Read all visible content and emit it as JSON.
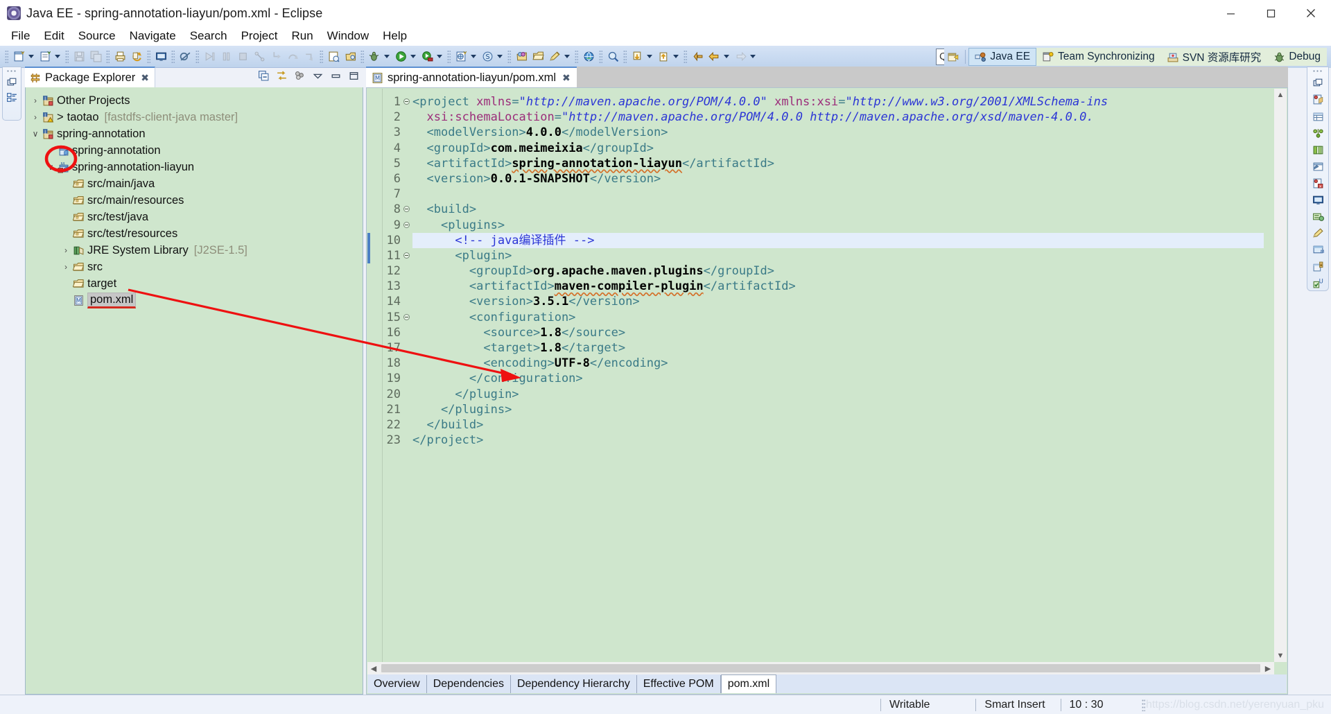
{
  "window": {
    "title": "Java EE - spring-annotation-liayun/pom.xml - Eclipse",
    "app_icon": "eclipse-icon",
    "controls": {
      "minimize": "minimize-icon",
      "maximize": "maximize-icon",
      "close": "close-icon"
    }
  },
  "menubar": {
    "items": [
      "File",
      "Edit",
      "Source",
      "Navigate",
      "Search",
      "Project",
      "Run",
      "Window",
      "Help"
    ]
  },
  "toolbar": {
    "groups": [
      {
        "buttons": [
          {
            "name": "new-wizard-icon",
            "arrow": true,
            "enabled": true
          },
          {
            "name": "new-java-file-icon",
            "arrow": true,
            "enabled": true
          }
        ]
      },
      {
        "buttons": [
          {
            "name": "save-icon",
            "arrow": false,
            "enabled": false
          },
          {
            "name": "save-all-icon",
            "arrow": false,
            "enabled": false
          }
        ]
      },
      {
        "buttons": [
          {
            "name": "print-icon",
            "arrow": false,
            "enabled": true
          },
          {
            "name": "refresh-icon",
            "arrow": false,
            "enabled": true
          }
        ]
      },
      {
        "buttons": [
          {
            "name": "open-console-icon",
            "arrow": false,
            "enabled": true
          }
        ]
      },
      {
        "buttons": [
          {
            "name": "toggle-breakpoint-icon",
            "arrow": false,
            "enabled": true
          }
        ]
      },
      {
        "buttons": [
          {
            "name": "resume-icon",
            "arrow": false,
            "enabled": false
          },
          {
            "name": "suspend-icon",
            "arrow": false,
            "enabled": false
          },
          {
            "name": "terminate-icon",
            "arrow": false,
            "enabled": false
          },
          {
            "name": "disconnect-icon",
            "arrow": false,
            "enabled": false
          },
          {
            "name": "step-into-icon",
            "arrow": false,
            "enabled": false
          },
          {
            "name": "step-over-icon",
            "arrow": false,
            "enabled": false
          },
          {
            "name": "step-return-icon",
            "arrow": false,
            "enabled": false
          }
        ]
      },
      {
        "buttons": [
          {
            "name": "open-type-icon",
            "arrow": false,
            "enabled": true
          },
          {
            "name": "open-task-icon",
            "arrow": false,
            "enabled": true
          }
        ]
      },
      {
        "buttons": [
          {
            "name": "debug-launch-icon",
            "arrow": true,
            "enabled": true
          },
          {
            "name": "run-launch-icon",
            "arrow": true,
            "enabled": true
          },
          {
            "name": "run-external-tools-icon",
            "arrow": true,
            "enabled": true
          }
        ]
      },
      {
        "buttons": [
          {
            "name": "new-server-icon",
            "arrow": true,
            "enabled": true
          },
          {
            "name": "new-ejb-project-icon",
            "arrow": true,
            "enabled": true
          }
        ]
      },
      {
        "buttons": [
          {
            "name": "open-web-browser-icon",
            "arrow": false,
            "enabled": true
          },
          {
            "name": "open-folder-icon",
            "arrow": false,
            "enabled": true
          },
          {
            "name": "edit-pencil-icon",
            "arrow": true,
            "enabled": true
          }
        ]
      },
      {
        "buttons": [
          {
            "name": "globe-icon",
            "arrow": false,
            "enabled": true
          }
        ]
      },
      {
        "buttons": [
          {
            "name": "search-icon",
            "arrow": false,
            "enabled": true
          }
        ]
      },
      {
        "buttons": [
          {
            "name": "commit-icon",
            "arrow": true,
            "enabled": true
          },
          {
            "name": "update-icon",
            "arrow": true,
            "enabled": true
          }
        ]
      },
      {
        "buttons": [
          {
            "name": "previous-annotation-icon",
            "arrow": false,
            "enabled": true
          },
          {
            "name": "back-navigation-icon",
            "arrow": true,
            "enabled": true
          },
          {
            "name": "forward-navigation-icon",
            "arrow": true,
            "enabled": false
          }
        ]
      }
    ]
  },
  "quick_access": {
    "label": "Quick Access",
    "placeholder": "Quick Access"
  },
  "perspectives": {
    "open_button": "open-perspective-icon",
    "items": [
      {
        "label": "Java EE",
        "icon": "java-ee-perspective-icon",
        "active": true
      },
      {
        "label": "Team Synchronizing",
        "icon": "team-sync-perspective-icon",
        "active": false
      },
      {
        "label": "SVN 资源库研究",
        "icon": "svn-repo-perspective-icon",
        "active": false
      },
      {
        "label": "Debug",
        "icon": "debug-perspective-icon",
        "active": false
      }
    ]
  },
  "left_stack": {
    "items": [
      {
        "name": "restore-view-icon"
      },
      {
        "name": "outline-view-icon"
      }
    ]
  },
  "package_explorer": {
    "tab_label": "Package Explorer",
    "tab_icon": "package-explorer-icon",
    "close_icon": "close-tab-icon",
    "tools": [
      {
        "name": "collapse-all-icon"
      },
      {
        "name": "link-with-editor-icon"
      },
      {
        "name": "view-menu-icon"
      },
      {
        "name": "minimize-view-icon"
      },
      {
        "name": "maximize-view-icon"
      }
    ],
    "tree": [
      {
        "indent": 0,
        "twisty": "collapsed",
        "icon": "java-project-closed-icon",
        "label": "Other Projects",
        "sub": "",
        "prefix": "",
        "selected": false
      },
      {
        "indent": 0,
        "twisty": "collapsed",
        "icon": "java-project-warn-icon",
        "label": "taotao",
        "sub": "[fastdfs-client-java master]",
        "prefix": ">",
        "selected": false
      },
      {
        "indent": 0,
        "twisty": "expanded",
        "icon": "maven-project-icon",
        "label": "spring-annotation",
        "sub": "",
        "prefix": "",
        "selected": false
      },
      {
        "indent": 1,
        "twisty": "collapsed",
        "icon": "maven-module-icon",
        "label": "spring-annotation",
        "sub": "",
        "prefix": "",
        "selected": false
      },
      {
        "indent": 1,
        "twisty": "expanded",
        "icon": "maven-module-error-icon",
        "label": "spring-annotation-liayun",
        "sub": "",
        "prefix": "",
        "selected": false,
        "circled": true
      },
      {
        "indent": 2,
        "twisty": "none",
        "icon": "source-folder-icon",
        "label": "src/main/java",
        "sub": "",
        "prefix": "",
        "selected": false
      },
      {
        "indent": 2,
        "twisty": "none",
        "icon": "source-folder-icon",
        "label": "src/main/resources",
        "sub": "",
        "prefix": "",
        "selected": false
      },
      {
        "indent": 2,
        "twisty": "none",
        "icon": "source-folder-icon",
        "label": "src/test/java",
        "sub": "",
        "prefix": "",
        "selected": false
      },
      {
        "indent": 2,
        "twisty": "none",
        "icon": "source-folder-icon",
        "label": "src/test/resources",
        "sub": "",
        "prefix": "",
        "selected": false
      },
      {
        "indent": 2,
        "twisty": "collapsed",
        "icon": "jre-library-icon",
        "label": "JRE System Library",
        "sub": "[J2SE-1.5]",
        "prefix": "",
        "selected": false
      },
      {
        "indent": 2,
        "twisty": "collapsed",
        "icon": "folder-icon",
        "label": "src",
        "sub": "",
        "prefix": "",
        "selected": false
      },
      {
        "indent": 2,
        "twisty": "none",
        "icon": "folder-icon",
        "label": "target",
        "sub": "",
        "prefix": "",
        "selected": false
      },
      {
        "indent": 2,
        "twisty": "none",
        "icon": "maven-pom-icon",
        "label": "pom.xml",
        "sub": "",
        "prefix": "",
        "selected": true
      }
    ]
  },
  "editor": {
    "tab": {
      "label": "spring-annotation-liayun/pom.xml",
      "icon": "maven-pom-icon",
      "close_icon": "close-tab-icon"
    },
    "current_line": 10,
    "lines": [
      {
        "no": 1,
        "fold": true,
        "tokens": [
          {
            "t": "punc",
            "v": "<"
          },
          {
            "t": "tag",
            "v": "project"
          },
          {
            "t": "plain",
            "v": " "
          },
          {
            "t": "attr",
            "v": "xmlns"
          },
          {
            "t": "punc",
            "v": "="
          },
          {
            "t": "str",
            "v": "\"http://maven.apache.org/POM/4.0.0\""
          },
          {
            "t": "plain",
            "v": " "
          },
          {
            "t": "attr",
            "v": "xmlns:xsi"
          },
          {
            "t": "punc",
            "v": "="
          },
          {
            "t": "str",
            "v": "\"http://www.w3.org/2001/XMLSchema-ins"
          }
        ]
      },
      {
        "no": 2,
        "fold": false,
        "tokens": [
          {
            "t": "plain",
            "v": "  "
          },
          {
            "t": "attr",
            "v": "xsi:schemaLocation"
          },
          {
            "t": "punc",
            "v": "="
          },
          {
            "t": "str",
            "v": "\"http://maven.apache.org/POM/4.0.0 http://maven.apache.org/xsd/maven-4.0.0."
          }
        ]
      },
      {
        "no": 3,
        "fold": false,
        "tokens": [
          {
            "t": "plain",
            "v": "  "
          },
          {
            "t": "tag",
            "v": "<modelVersion>"
          },
          {
            "t": "val",
            "v": "4.0.0"
          },
          {
            "t": "tag",
            "v": "</modelVersion>"
          }
        ]
      },
      {
        "no": 4,
        "fold": false,
        "tokens": [
          {
            "t": "plain",
            "v": "  "
          },
          {
            "t": "tag",
            "v": "<groupId>"
          },
          {
            "t": "val",
            "v": "com.meimeixia"
          },
          {
            "t": "tag",
            "v": "</groupId>"
          }
        ]
      },
      {
        "no": 5,
        "fold": false,
        "tokens": [
          {
            "t": "plain",
            "v": "  "
          },
          {
            "t": "tag",
            "v": "<artifactId>"
          },
          {
            "t": "val-sq",
            "v": "spring-annotation-liayun"
          },
          {
            "t": "tag",
            "v": "</artifactId>"
          }
        ]
      },
      {
        "no": 6,
        "fold": false,
        "tokens": [
          {
            "t": "plain",
            "v": "  "
          },
          {
            "t": "tag",
            "v": "<version>"
          },
          {
            "t": "val",
            "v": "0.0.1-SNAPSHOT"
          },
          {
            "t": "tag",
            "v": "</version>"
          }
        ]
      },
      {
        "no": 7,
        "fold": false,
        "tokens": []
      },
      {
        "no": 8,
        "fold": true,
        "tokens": [
          {
            "t": "plain",
            "v": "  "
          },
          {
            "t": "tag",
            "v": "<build>"
          }
        ]
      },
      {
        "no": 9,
        "fold": true,
        "tokens": [
          {
            "t": "plain",
            "v": "    "
          },
          {
            "t": "tag",
            "v": "<plugins>"
          }
        ]
      },
      {
        "no": 10,
        "fold": false,
        "tokens": [
          {
            "t": "plain",
            "v": "      "
          },
          {
            "t": "cmt",
            "v": "<!-- java编译插件 -->"
          }
        ]
      },
      {
        "no": 11,
        "fold": true,
        "tokens": [
          {
            "t": "plain",
            "v": "      "
          },
          {
            "t": "tag",
            "v": "<plugin>"
          }
        ]
      },
      {
        "no": 12,
        "fold": false,
        "tokens": [
          {
            "t": "plain",
            "v": "        "
          },
          {
            "t": "tag",
            "v": "<groupId>"
          },
          {
            "t": "val",
            "v": "org.apache.maven.plugins"
          },
          {
            "t": "tag",
            "v": "</groupId>"
          }
        ]
      },
      {
        "no": 13,
        "fold": false,
        "tokens": [
          {
            "t": "plain",
            "v": "        "
          },
          {
            "t": "tag",
            "v": "<artifactId>"
          },
          {
            "t": "val-sq",
            "v": "maven-compiler-plugin"
          },
          {
            "t": "tag",
            "v": "</artifactId>"
          }
        ]
      },
      {
        "no": 14,
        "fold": false,
        "tokens": [
          {
            "t": "plain",
            "v": "        "
          },
          {
            "t": "tag",
            "v": "<version>"
          },
          {
            "t": "val",
            "v": "3.5.1"
          },
          {
            "t": "tag",
            "v": "</version>"
          }
        ]
      },
      {
        "no": 15,
        "fold": true,
        "tokens": [
          {
            "t": "plain",
            "v": "        "
          },
          {
            "t": "tag",
            "v": "<configuration>"
          }
        ]
      },
      {
        "no": 16,
        "fold": false,
        "tokens": [
          {
            "t": "plain",
            "v": "          "
          },
          {
            "t": "tag",
            "v": "<source>"
          },
          {
            "t": "val",
            "v": "1.8"
          },
          {
            "t": "tag",
            "v": "</source>"
          }
        ]
      },
      {
        "no": 17,
        "fold": false,
        "tokens": [
          {
            "t": "plain",
            "v": "          "
          },
          {
            "t": "tag",
            "v": "<target>"
          },
          {
            "t": "val",
            "v": "1.8"
          },
          {
            "t": "tag",
            "v": "</target>"
          }
        ]
      },
      {
        "no": 18,
        "fold": false,
        "tokens": [
          {
            "t": "plain",
            "v": "          "
          },
          {
            "t": "tag",
            "v": "<encoding>"
          },
          {
            "t": "val",
            "v": "UTF-8"
          },
          {
            "t": "tag",
            "v": "</encoding>"
          }
        ]
      },
      {
        "no": 19,
        "fold": false,
        "tokens": [
          {
            "t": "plain",
            "v": "        "
          },
          {
            "t": "tag",
            "v": "</configuration>"
          }
        ]
      },
      {
        "no": 20,
        "fold": false,
        "tokens": [
          {
            "t": "plain",
            "v": "      "
          },
          {
            "t": "tag",
            "v": "</plugin>"
          }
        ]
      },
      {
        "no": 21,
        "fold": false,
        "tokens": [
          {
            "t": "plain",
            "v": "    "
          },
          {
            "t": "tag",
            "v": "</plugins>"
          }
        ]
      },
      {
        "no": 22,
        "fold": false,
        "tokens": [
          {
            "t": "plain",
            "v": "  "
          },
          {
            "t": "tag",
            "v": "</build>"
          }
        ]
      },
      {
        "no": 23,
        "fold": false,
        "tokens": [
          {
            "t": "tag",
            "v": "</project>"
          }
        ]
      }
    ],
    "page_tabs": [
      {
        "label": "Overview",
        "active": false
      },
      {
        "label": "Dependencies",
        "active": false
      },
      {
        "label": "Dependency Hierarchy",
        "active": false
      },
      {
        "label": "Effective POM",
        "active": false
      },
      {
        "label": "pom.xml",
        "active": true
      }
    ],
    "scroll_prev_icon": "scroll-left-icon",
    "scroll_next_icon": "scroll-right-icon"
  },
  "right_bar": {
    "items": [
      {
        "name": "restore-view-icon"
      },
      {
        "name": "servers-view-icon"
      },
      {
        "name": "data-source-explorer-icon"
      },
      {
        "name": "snippets-view-icon"
      },
      {
        "name": "project-explorer-icon"
      },
      {
        "name": "properties-view-icon"
      },
      {
        "name": "problems-view-icon"
      },
      {
        "name": "console-view-icon"
      },
      {
        "name": "progress-view-icon"
      },
      {
        "name": "markers-view-icon"
      },
      {
        "name": "svn-repositories-icon"
      },
      {
        "name": "history-view-icon"
      },
      {
        "name": "junit-view-icon"
      }
    ]
  },
  "statusbar": {
    "writable": "Writable",
    "insert_mode": "Smart Insert",
    "cursor_position": "10 : 30",
    "watermark": "https://blog.csdn.net/yerenyuan_pku"
  },
  "annotations": {
    "arrow_color": "#ee1111",
    "circle_color": "#ee1111",
    "underline_color": "#e01717"
  }
}
